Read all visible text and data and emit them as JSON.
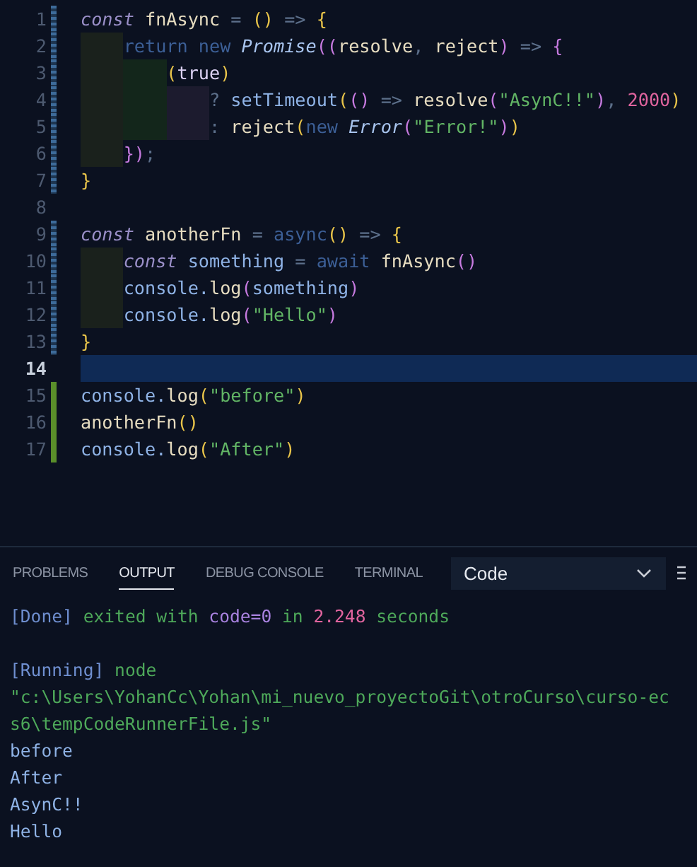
{
  "editor": {
    "lines": [
      {
        "number": "1",
        "modified": true,
        "added": false,
        "current": false,
        "tokens": [
          {
            "kind": "kw",
            "text": "const"
          },
          {
            "kind": "plain",
            "text": " fnAsync "
          },
          {
            "kind": "op",
            "text": "= "
          },
          {
            "kind": "paren",
            "text": "() "
          },
          {
            "kind": "op",
            "text": "=> "
          },
          {
            "kind": "paren",
            "text": "{"
          }
        ]
      },
      {
        "number": "2",
        "modified": true,
        "added": false,
        "current": false,
        "tokens": [
          {
            "kind": "indent"
          },
          {
            "kind": "dim",
            "text": "return new "
          },
          {
            "kind": "type",
            "text": "Promise"
          },
          {
            "kind": "paren2",
            "text": "(("
          },
          {
            "kind": "plain",
            "text": "resolve"
          },
          {
            "kind": "op",
            "text": ", "
          },
          {
            "kind": "plain",
            "text": "reject"
          },
          {
            "kind": "paren2",
            "text": ")"
          },
          {
            "kind": "op",
            "text": " => "
          },
          {
            "kind": "paren2",
            "text": "{"
          }
        ]
      },
      {
        "number": "3",
        "modified": true,
        "added": false,
        "current": false,
        "tokens": [
          {
            "kind": "indent"
          },
          {
            "kind": "indent"
          },
          {
            "kind": "paren",
            "text": "("
          },
          {
            "kind": "lit",
            "text": "true"
          },
          {
            "kind": "paren",
            "text": ")"
          }
        ]
      },
      {
        "number": "4",
        "modified": true,
        "added": false,
        "current": false,
        "tokens": [
          {
            "kind": "indent"
          },
          {
            "kind": "indent"
          },
          {
            "kind": "indent"
          },
          {
            "kind": "op",
            "text": "? "
          },
          {
            "kind": "obj",
            "text": "setTimeout"
          },
          {
            "kind": "paren",
            "text": "("
          },
          {
            "kind": "paren2",
            "text": "()"
          },
          {
            "kind": "op",
            "text": " => "
          },
          {
            "kind": "plain",
            "text": "resolve"
          },
          {
            "kind": "paren2",
            "text": "("
          },
          {
            "kind": "str",
            "text": "\"AsynC!!\""
          },
          {
            "kind": "paren2",
            "text": ")"
          },
          {
            "kind": "op",
            "text": ", "
          },
          {
            "kind": "num",
            "text": "2000"
          },
          {
            "kind": "paren",
            "text": ")"
          }
        ]
      },
      {
        "number": "5",
        "modified": true,
        "added": false,
        "current": false,
        "tokens": [
          {
            "kind": "indent"
          },
          {
            "kind": "indent"
          },
          {
            "kind": "indent"
          },
          {
            "kind": "op",
            "text": ": "
          },
          {
            "kind": "plain",
            "text": "reject"
          },
          {
            "kind": "paren",
            "text": "("
          },
          {
            "kind": "dim",
            "text": "new "
          },
          {
            "kind": "type",
            "text": "Error"
          },
          {
            "kind": "paren2",
            "text": "("
          },
          {
            "kind": "str",
            "text": "\"Error!\""
          },
          {
            "kind": "paren2",
            "text": ")"
          },
          {
            "kind": "paren",
            "text": ")"
          }
        ]
      },
      {
        "number": "6",
        "modified": true,
        "added": false,
        "current": false,
        "tokens": [
          {
            "kind": "indent"
          },
          {
            "kind": "paren2",
            "text": "})"
          },
          {
            "kind": "op",
            "text": ";"
          }
        ]
      },
      {
        "number": "7",
        "modified": true,
        "added": false,
        "current": false,
        "tokens": [
          {
            "kind": "paren",
            "text": "}"
          }
        ]
      },
      {
        "number": "8",
        "modified": false,
        "added": false,
        "current": false
      },
      {
        "number": "9",
        "modified": true,
        "added": false,
        "current": false,
        "tokens": [
          {
            "kind": "kw",
            "text": "const"
          },
          {
            "kind": "plain",
            "text": " anotherFn "
          },
          {
            "kind": "op",
            "text": "= "
          },
          {
            "kind": "dim",
            "text": "async"
          },
          {
            "kind": "paren",
            "text": "() "
          },
          {
            "kind": "op",
            "text": "=> "
          },
          {
            "kind": "paren",
            "text": "{"
          }
        ]
      },
      {
        "number": "10",
        "modified": true,
        "added": false,
        "current": false,
        "tokens": [
          {
            "kind": "indent"
          },
          {
            "kind": "kw",
            "text": "const"
          },
          {
            "kind": "obj",
            "text": " something "
          },
          {
            "kind": "op",
            "text": "= "
          },
          {
            "kind": "dim",
            "text": "await "
          },
          {
            "kind": "plain",
            "text": "fnAsync"
          },
          {
            "kind": "paren2",
            "text": "()"
          }
        ]
      },
      {
        "number": "11",
        "modified": true,
        "added": false,
        "current": false,
        "tokens": [
          {
            "kind": "indent"
          },
          {
            "kind": "obj",
            "text": "console."
          },
          {
            "kind": "plain",
            "text": "log"
          },
          {
            "kind": "paren2",
            "text": "("
          },
          {
            "kind": "obj",
            "text": "something"
          },
          {
            "kind": "paren2",
            "text": ")"
          }
        ]
      },
      {
        "number": "12",
        "modified": true,
        "added": false,
        "current": false,
        "tokens": [
          {
            "kind": "indent"
          },
          {
            "kind": "obj",
            "text": "console."
          },
          {
            "kind": "plain",
            "text": "log"
          },
          {
            "kind": "paren2",
            "text": "("
          },
          {
            "kind": "str",
            "text": "\"Hello\""
          },
          {
            "kind": "paren2",
            "text": ")"
          }
        ]
      },
      {
        "number": "13",
        "modified": true,
        "added": false,
        "current": false,
        "tokens": [
          {
            "kind": "paren",
            "text": "}"
          }
        ]
      },
      {
        "number": "14",
        "modified": false,
        "added": false,
        "current": true
      },
      {
        "number": "15",
        "modified": false,
        "added": true,
        "current": false,
        "tokens": [
          {
            "kind": "obj",
            "text": "console."
          },
          {
            "kind": "plain",
            "text": "log"
          },
          {
            "kind": "paren",
            "text": "("
          },
          {
            "kind": "str",
            "text": "\"before\""
          },
          {
            "kind": "paren",
            "text": ")"
          }
        ]
      },
      {
        "number": "16",
        "modified": false,
        "added": true,
        "current": false,
        "tokens": [
          {
            "kind": "plain",
            "text": "anotherFn"
          },
          {
            "kind": "paren",
            "text": "()"
          }
        ]
      },
      {
        "number": "17",
        "modified": false,
        "added": true,
        "current": false,
        "tokens": [
          {
            "kind": "obj",
            "text": "console."
          },
          {
            "kind": "plain",
            "text": "log"
          },
          {
            "kind": "paren",
            "text": "("
          },
          {
            "kind": "str",
            "text": "\"After\""
          },
          {
            "kind": "paren",
            "text": ")"
          }
        ]
      }
    ]
  },
  "panel": {
    "tabs": [
      {
        "label": "PROBLEMS",
        "selected": false
      },
      {
        "label": "OUTPUT",
        "selected": true
      },
      {
        "label": "DEBUG CONSOLE",
        "selected": false
      },
      {
        "label": "TERMINAL",
        "selected": false
      }
    ],
    "channel_dropdown": {
      "value": "Code"
    },
    "output_blocks": [
      {
        "lines": [
          {
            "tokens": [
              {
                "kind": "tag",
                "text": "[Done]"
              },
              {
                "kind": "ok",
                "text": " exited with "
              },
              {
                "kind": "code",
                "text": "code=0"
              },
              {
                "kind": "ok",
                "text": " in "
              },
              {
                "kind": "num",
                "text": "2.248"
              },
              {
                "kind": "ok",
                "text": " seconds"
              }
            ]
          }
        ]
      },
      {
        "lines": [
          {
            "tokens": [
              {
                "kind": "tag",
                "text": "[Running]"
              },
              {
                "kind": "ok",
                "text": " node"
              }
            ]
          },
          {
            "tokens": [
              {
                "kind": "ok",
                "text": "\"c:\\Users\\YohanCc\\Yohan\\mi_nuevo_proyectoGit\\otroCurso\\curso-ec"
              }
            ]
          },
          {
            "tokens": [
              {
                "kind": "ok",
                "text": "s6\\tempCodeRunnerFile.js\""
              }
            ]
          },
          {
            "tokens": [
              {
                "kind": "out",
                "text": "before"
              }
            ]
          },
          {
            "tokens": [
              {
                "kind": "out",
                "text": "After"
              }
            ]
          },
          {
            "tokens": [
              {
                "kind": "out",
                "text": "AsynC!!"
              }
            ]
          },
          {
            "tokens": [
              {
                "kind": "out",
                "text": "Hello"
              }
            ]
          }
        ]
      }
    ]
  }
}
